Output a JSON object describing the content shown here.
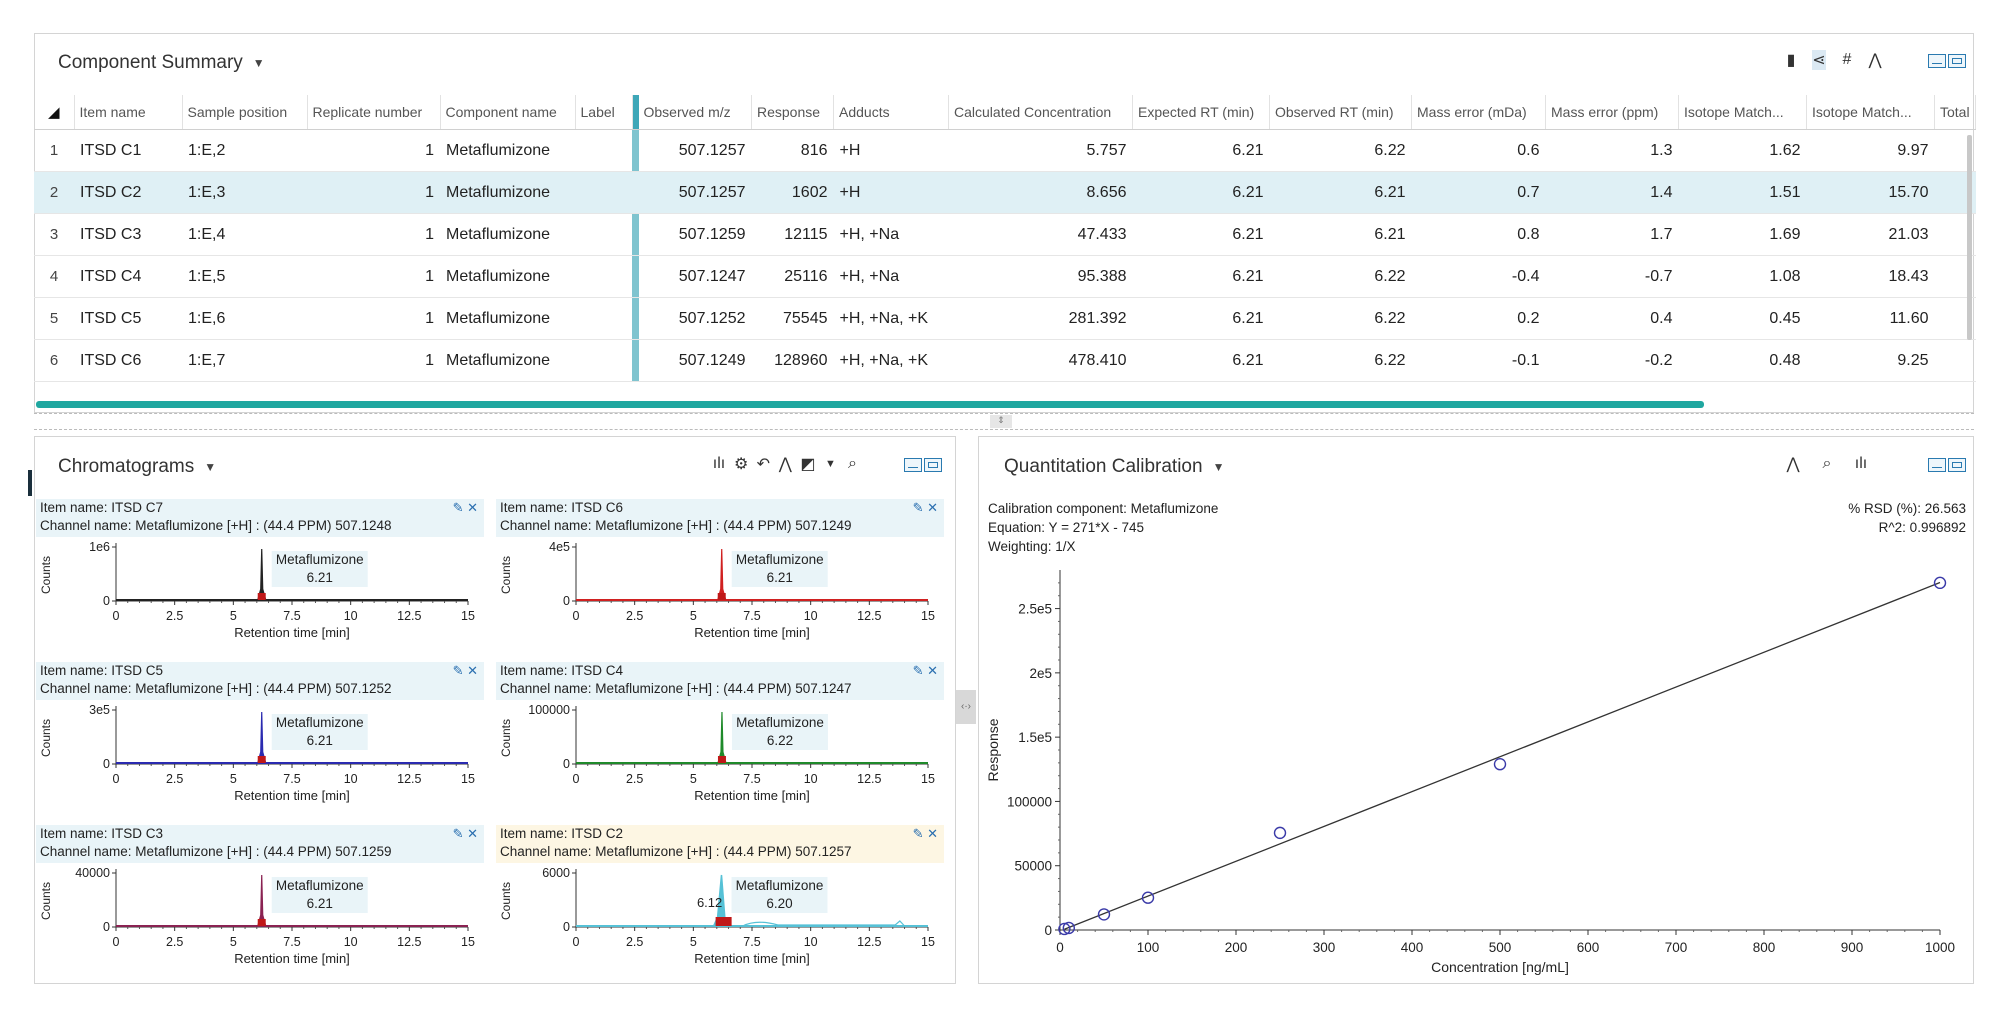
{
  "component_summary": {
    "title": "Component Summary",
    "toolbar_icons": [
      "flask-icon",
      "share-icon",
      "hash-icon",
      "peak-icon"
    ],
    "columns": [
      "Item name",
      "Sample position",
      "Replicate number",
      "Component name",
      "Label",
      "Observed m/z",
      "Response",
      "Adducts",
      "Calculated Concentration",
      "Expected RT (min)",
      "Observed RT (min)",
      "Mass error (mDa)",
      "Mass error (ppm)",
      "Isotope Match...",
      "Isotope Match...",
      "Total"
    ],
    "rows": [
      {
        "idx": "1",
        "item": "ITSD C1",
        "pos": "1:E,2",
        "rep": "1",
        "comp": "Metaflumizone",
        "label": "",
        "mz": "507.1257",
        "resp": "816",
        "adducts": "+H",
        "conc": "5.757",
        "exp_rt": "6.21",
        "obs_rt": "6.22",
        "mda": "0.6",
        "ppm": "1.3",
        "iso1": "1.62",
        "iso2": "9.97",
        "total": ""
      },
      {
        "idx": "2",
        "item": "ITSD C2",
        "pos": "1:E,3",
        "rep": "1",
        "comp": "Metaflumizone",
        "label": "",
        "mz": "507.1257",
        "resp": "1602",
        "adducts": "+H",
        "conc": "8.656",
        "exp_rt": "6.21",
        "obs_rt": "6.21",
        "mda": "0.7",
        "ppm": "1.4",
        "iso1": "1.51",
        "iso2": "15.70",
        "total": ""
      },
      {
        "idx": "3",
        "item": "ITSD C3",
        "pos": "1:E,4",
        "rep": "1",
        "comp": "Metaflumizone",
        "label": "",
        "mz": "507.1259",
        "resp": "12115",
        "adducts": "+H, +Na",
        "conc": "47.433",
        "exp_rt": "6.21",
        "obs_rt": "6.21",
        "mda": "0.8",
        "ppm": "1.7",
        "iso1": "1.69",
        "iso2": "21.03",
        "total": ""
      },
      {
        "idx": "4",
        "item": "ITSD C4",
        "pos": "1:E,5",
        "rep": "1",
        "comp": "Metaflumizone",
        "label": "",
        "mz": "507.1247",
        "resp": "25116",
        "adducts": "+H, +Na",
        "conc": "95.388",
        "exp_rt": "6.21",
        "obs_rt": "6.22",
        "mda": "-0.4",
        "ppm": "-0.7",
        "iso1": "1.08",
        "iso2": "18.43",
        "total": ""
      },
      {
        "idx": "5",
        "item": "ITSD C5",
        "pos": "1:E,6",
        "rep": "1",
        "comp": "Metaflumizone",
        "label": "",
        "mz": "507.1252",
        "resp": "75545",
        "adducts": "+H, +Na, +K",
        "conc": "281.392",
        "exp_rt": "6.21",
        "obs_rt": "6.22",
        "mda": "0.2",
        "ppm": "0.4",
        "iso1": "0.45",
        "iso2": "11.60",
        "total": ""
      },
      {
        "idx": "6",
        "item": "ITSD C6",
        "pos": "1:E,7",
        "rep": "1",
        "comp": "Metaflumizone",
        "label": "",
        "mz": "507.1249",
        "resp": "128960",
        "adducts": "+H, +Na, +K",
        "conc": "478.410",
        "exp_rt": "6.21",
        "obs_rt": "6.22",
        "mda": "-0.1",
        "ppm": "-0.2",
        "iso1": "0.48",
        "iso2": "9.25",
        "total": ""
      }
    ]
  },
  "chromatograms": {
    "title": "Chromatograms",
    "toolbar_icons": [
      "peak-bars-icon",
      "gear-icon",
      "undo-icon",
      "integrate-icon",
      "chart-options-icon",
      "dropdown-icon",
      "zoom-icon"
    ],
    "x_ticks": [
      "0",
      "2.5",
      "5",
      "7.5",
      "10",
      "12.5",
      "15"
    ],
    "x_label": "Retention time [min]",
    "y_label": "Counts",
    "cells": [
      {
        "item": "Item name: ITSD C7",
        "channel": "Channel name: Metaflumizone [+H] : (44.4 PPM) 507.1248",
        "ytop": "1e6",
        "peak_name": "Metaflumizone",
        "peak_rt": "6.21",
        "extra_rt": "",
        "color": "#222222",
        "highlight": false
      },
      {
        "item": "Item name: ITSD C6",
        "channel": "Channel name: Metaflumizone [+H] : (44.4 PPM) 507.1249",
        "ytop": "4e5",
        "peak_name": "Metaflumizone",
        "peak_rt": "6.21",
        "extra_rt": "",
        "color": "#d02020",
        "highlight": false
      },
      {
        "item": "Item name: ITSD C5",
        "channel": "Channel name: Metaflumizone [+H] : (44.4 PPM) 507.1252",
        "ytop": "3e5",
        "peak_name": "Metaflumizone",
        "peak_rt": "6.21",
        "extra_rt": "",
        "color": "#2a2ab0",
        "highlight": false
      },
      {
        "item": "Item name: ITSD C4",
        "channel": "Channel name: Metaflumizone [+H] : (44.4 PPM) 507.1247",
        "ytop": "100000",
        "peak_name": "Metaflumizone",
        "peak_rt": "6.22",
        "extra_rt": "",
        "color": "#1f8a2a",
        "highlight": false
      },
      {
        "item": "Item name: ITSD C3",
        "channel": "Channel name: Metaflumizone [+H] : (44.4 PPM) 507.1259",
        "ytop": "40000",
        "peak_name": "Metaflumizone",
        "peak_rt": "6.21",
        "extra_rt": "",
        "color": "#8a2252",
        "highlight": false
      },
      {
        "item": "Item name: ITSD C2",
        "channel": "Channel name: Metaflumizone [+H] : (44.4 PPM) 507.1257",
        "ytop": "6000",
        "peak_name": "Metaflumizone",
        "peak_rt": "6.20",
        "extra_rt": "6.12",
        "color": "#56c1d6",
        "highlight": true
      }
    ]
  },
  "calibration": {
    "title": "Quantitation Calibration",
    "toolbar_icons": [
      "integrate-icon",
      "zoom-icon",
      "peak-bars-icon"
    ],
    "component_line": "Calibration component: Metaflumizone",
    "equation_line": "Equation: Y = 271*X - 745",
    "weighting_line": "Weighting: 1/X",
    "rsd_line": "% RSD (%): 26.563",
    "r2_line": "R^2: 0.996892",
    "x_label": "Concentration [ng/mL]",
    "y_label": "Response",
    "x_ticks": [
      "0",
      "100",
      "200",
      "300",
      "400",
      "500",
      "600",
      "700",
      "800",
      "900",
      "1000"
    ],
    "y_ticks": [
      "0",
      "50000",
      "100000",
      "1.5e5",
      "2e5",
      "2.5e5"
    ]
  },
  "chart_data": [
    {
      "type": "scatter",
      "title": "Quantitation Calibration",
      "xlabel": "Concentration [ng/mL]",
      "ylabel": "Response",
      "xlim": [
        0,
        1000
      ],
      "ylim": [
        0,
        280000
      ],
      "series": [
        {
          "values": [
            {
              "x": 5,
              "y": 816
            },
            {
              "x": 10,
              "y": 1602
            },
            {
              "x": 50,
              "y": 12115
            },
            {
              "x": 100,
              "y": 25116
            },
            {
              "x": 250,
              "y": 75545
            },
            {
              "x": 500,
              "y": 128960
            },
            {
              "x": 1000,
              "y": 270000
            }
          ]
        }
      ],
      "fit": {
        "slope": 271,
        "intercept": -745
      }
    }
  ]
}
